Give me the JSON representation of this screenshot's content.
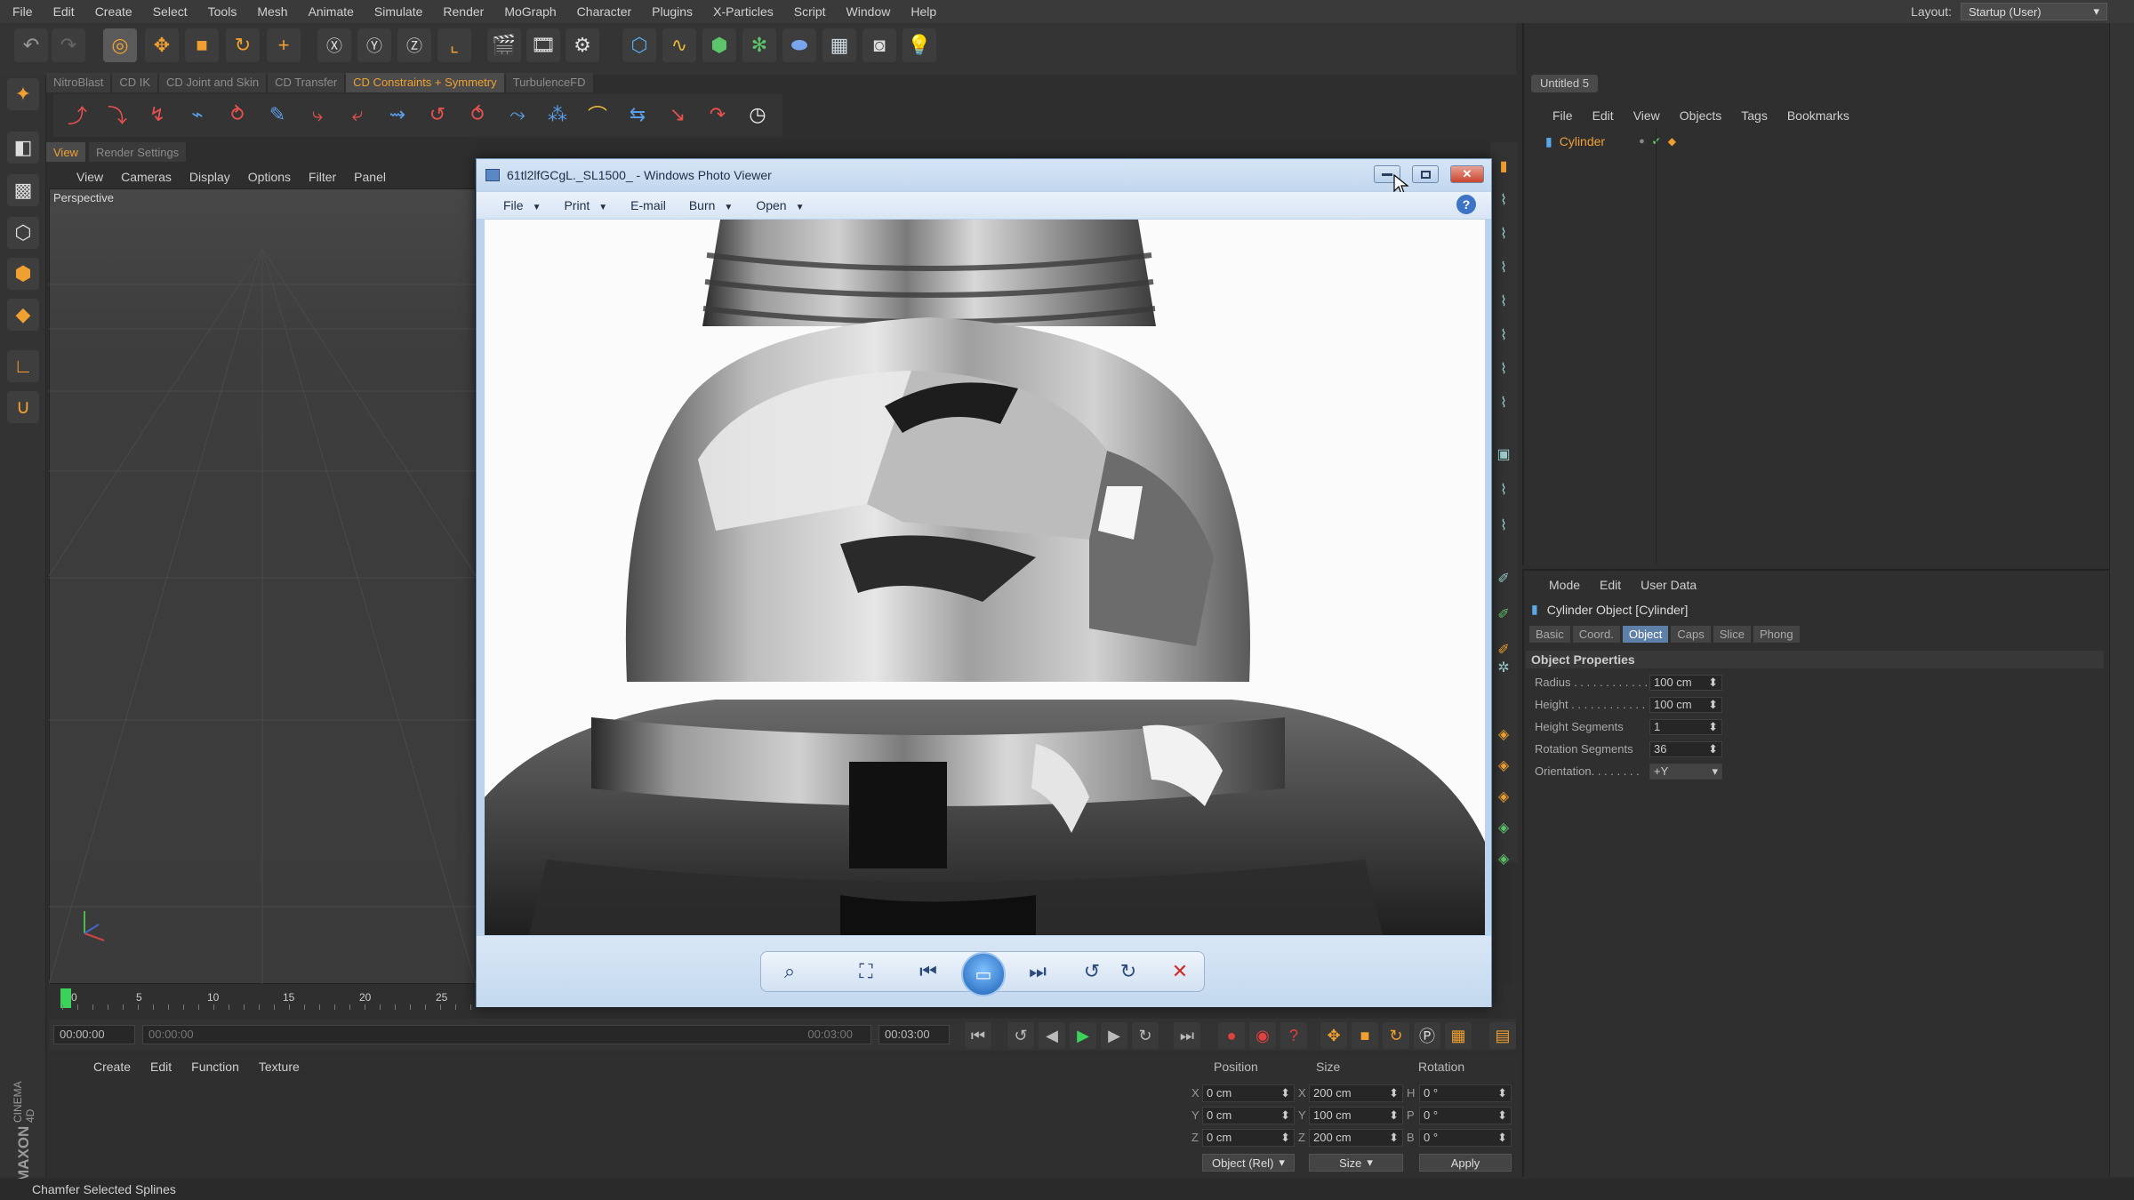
{
  "menubar": {
    "items": [
      "File",
      "Edit",
      "Create",
      "Select",
      "Tools",
      "Mesh",
      "Animate",
      "Simulate",
      "Render",
      "MoGraph",
      "Character",
      "Plugins",
      "X-Particles",
      "Script",
      "Window",
      "Help"
    ],
    "layout_label": "Layout:",
    "layout_value": "Startup (User)"
  },
  "plugin_tabs": [
    "NitroBlast",
    "CD IK",
    "CD Joint and Skin",
    "CD Transfer",
    "CD Constraints + Symmetry",
    "TurbulenceFD"
  ],
  "viewport": {
    "tabs": [
      "View",
      "Render Settings"
    ],
    "menu": [
      "View",
      "Cameras",
      "Display",
      "Options",
      "Filter",
      "Panel"
    ],
    "label": "Perspective"
  },
  "timeline": {
    "ticks": [
      "0",
      "5",
      "10",
      "15",
      "20",
      "25"
    ],
    "current_time": "00:00:00",
    "start_time": "00:00:00",
    "end_time_slider": "00:03:00",
    "end_time": "00:03:00"
  },
  "material_menu": [
    "Create",
    "Edit",
    "Function",
    "Texture"
  ],
  "coordinates": {
    "headers": [
      "Position",
      "Size",
      "Rotation"
    ],
    "pos": {
      "x": "0 cm",
      "y": "0 cm",
      "z": "0 cm"
    },
    "size": {
      "x": "200 cm",
      "y": "100 cm",
      "z": "200 cm"
    },
    "rot": {
      "h": "0 °",
      "p": "0 °",
      "b": "0 °"
    },
    "axis_pos": [
      "X",
      "Y",
      "Z"
    ],
    "axis_size": [
      "X",
      "Y",
      "Z"
    ],
    "axis_rot": [
      "H",
      "P",
      "B"
    ],
    "mode_select": "Object (Rel)",
    "size_select": "Size",
    "apply_label": "Apply"
  },
  "statusbar": {
    "text": "Chamfer Selected Splines"
  },
  "object_manager": {
    "doc_tab": "Untitled 5",
    "menu": [
      "File",
      "Edit",
      "View",
      "Objects",
      "Tags",
      "Bookmarks"
    ],
    "objects": [
      {
        "name": "Cylinder"
      }
    ]
  },
  "attributes": {
    "menu": [
      "Mode",
      "Edit",
      "User Data"
    ],
    "title": "Cylinder Object [Cylinder]",
    "tabs": [
      "Basic",
      "Coord.",
      "Object",
      "Caps",
      "Slice",
      "Phong"
    ],
    "active_tab": "Object",
    "section": "Object Properties",
    "props": [
      {
        "label": "Radius . . . . . . . . . . . .",
        "value": "100 cm"
      },
      {
        "label": "Height . . . . . . . . . . . .",
        "value": "100 cm"
      },
      {
        "label": "Height Segments",
        "value": "1"
      },
      {
        "label": "Rotation Segments",
        "value": "36"
      },
      {
        "label": "Orientation. . . . . . . .",
        "value": "+Y"
      }
    ]
  },
  "photo_viewer": {
    "title": "61tl2lfGCgL._SL1500_ - Windows Photo Viewer",
    "menu": [
      "File",
      "Print",
      "E-mail",
      "Burn",
      "Open"
    ],
    "help": "?"
  },
  "maxon": {
    "brand": "MAXON",
    "product": "CINEMA 4D"
  },
  "colors": {
    "accent": "#f0a030",
    "active_tab_blue": "#5e7fa8",
    "viewer_frame": "#bcd3ec"
  }
}
